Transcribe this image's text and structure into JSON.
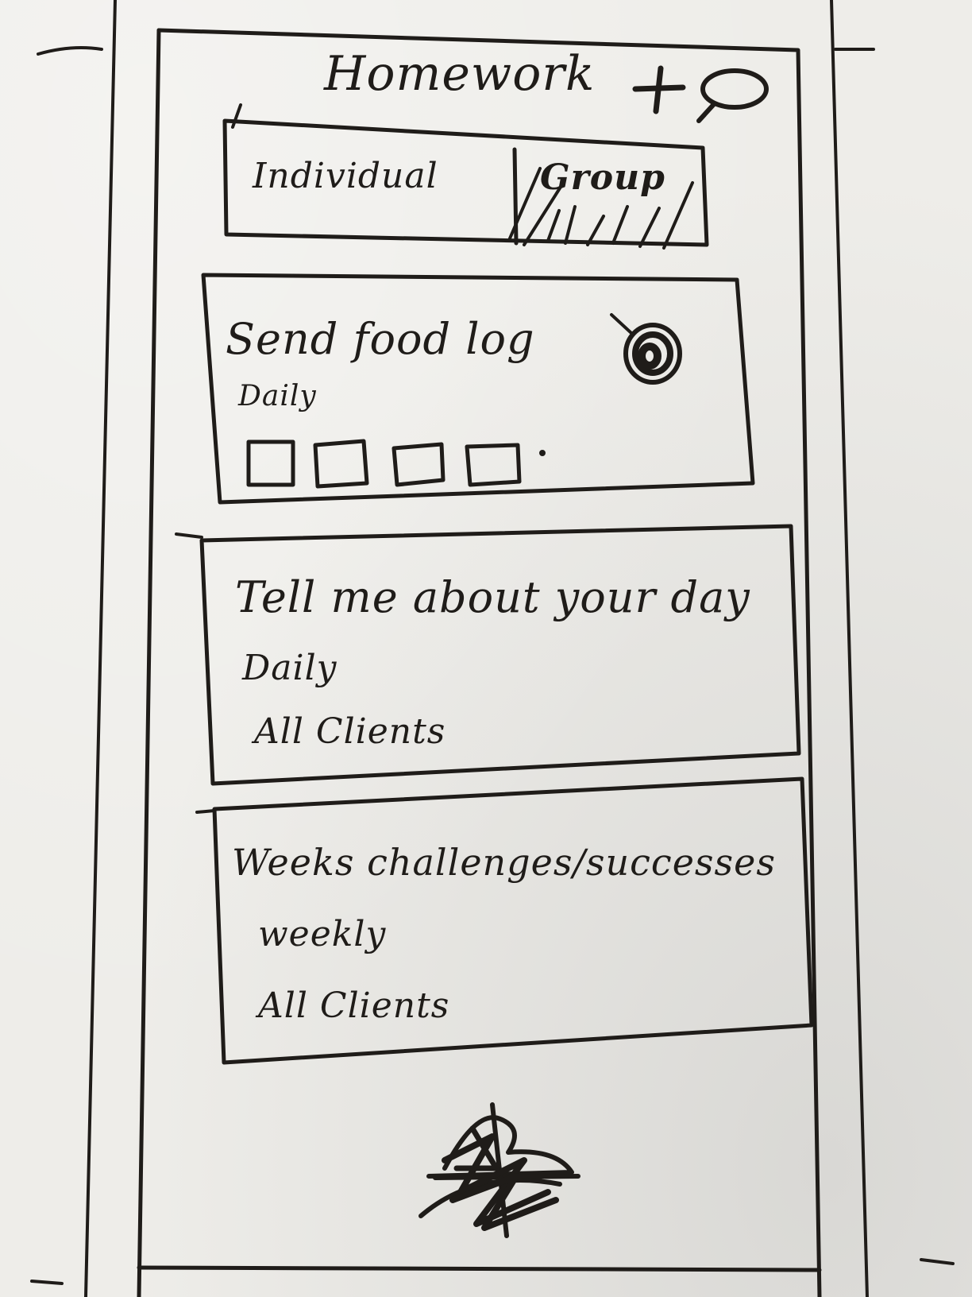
{
  "header": {
    "title": "Homework",
    "add_icon": "plus-icon",
    "search_icon": "search-icon"
  },
  "segmented": {
    "tabs": [
      {
        "label": "Individual",
        "selected": false
      },
      {
        "label": "Group",
        "selected": true
      }
    ]
  },
  "homework": [
    {
      "title": "Send food log",
      "frequency": "Daily",
      "status_icon": "completed-dot-icon",
      "checkbox_count": 4
    },
    {
      "title": "Tell me about your day",
      "frequency": "Daily",
      "audience": "All Clients"
    },
    {
      "title": "Weeks challenges/successes",
      "frequency": "weekly",
      "audience": "All Clients"
    }
  ],
  "bottom": {
    "icon": "scribbled-logo-icon"
  }
}
